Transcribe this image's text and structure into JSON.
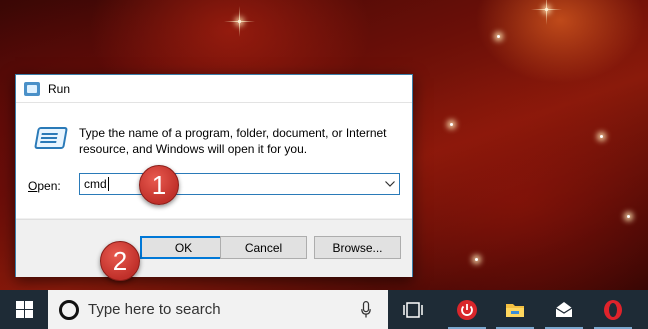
{
  "dialog": {
    "title": "Run",
    "description": "Type the name of a program, folder, document, or Internet resource, and Windows will open it for you.",
    "open_label_underlined": "O",
    "open_label_rest": "pen:",
    "open_value": "cmd",
    "buttons": {
      "ok": "OK",
      "cancel": "Cancel",
      "browse": "Browse..."
    }
  },
  "markers": {
    "step1": "1",
    "step2": "2"
  },
  "taskbar": {
    "search_placeholder": "Type here to search",
    "icons": [
      "windows-start-icon",
      "cortana-icon",
      "microphone-icon",
      "task-view-icon",
      "power-app-icon",
      "file-explorer-icon",
      "mail-icon",
      "opera-icon"
    ]
  },
  "colors": {
    "dialog_border": "#3b7fa9",
    "focus_blue": "#0078d7",
    "marker_red": "#c0302a",
    "taskbar": "#1e2b36"
  }
}
